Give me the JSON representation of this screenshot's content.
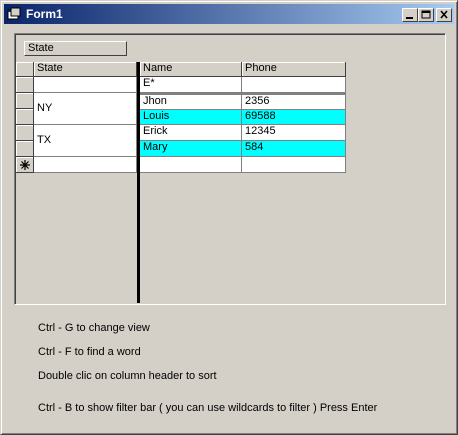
{
  "window": {
    "title": "Form1"
  },
  "group_by": {
    "label": "State"
  },
  "left_grid": {
    "header": "State",
    "groups": [
      "NY",
      "TX"
    ]
  },
  "right_grid": {
    "headers": [
      "Name",
      "Phone"
    ],
    "filter": {
      "name": "E*",
      "phone": ""
    },
    "rows": [
      {
        "name": "Jhon",
        "phone": "2356",
        "highlight": false
      },
      {
        "name": "Louis",
        "phone": "69588",
        "highlight": true
      },
      {
        "name": "Erick",
        "phone": "12345",
        "highlight": false
      },
      {
        "name": "Mary",
        "phone": "584",
        "highlight": true
      }
    ]
  },
  "help": {
    "line1": "Ctrl - G    to change view",
    "line2": "Ctrl - F    to find a word",
    "line3": "Double clic on column header to sort",
    "line4": "Ctrl - B    to show filter bar ( you can use wildcards to filter ) Press Enter"
  },
  "colors": {
    "title_start": "#0a246a",
    "title_end": "#a6caf0",
    "highlight": "#00ffff",
    "face": "#d4d0c8"
  },
  "icons": [
    "app-icon",
    "minimize-icon",
    "maximize-icon",
    "close-icon",
    "new-row-icon"
  ]
}
